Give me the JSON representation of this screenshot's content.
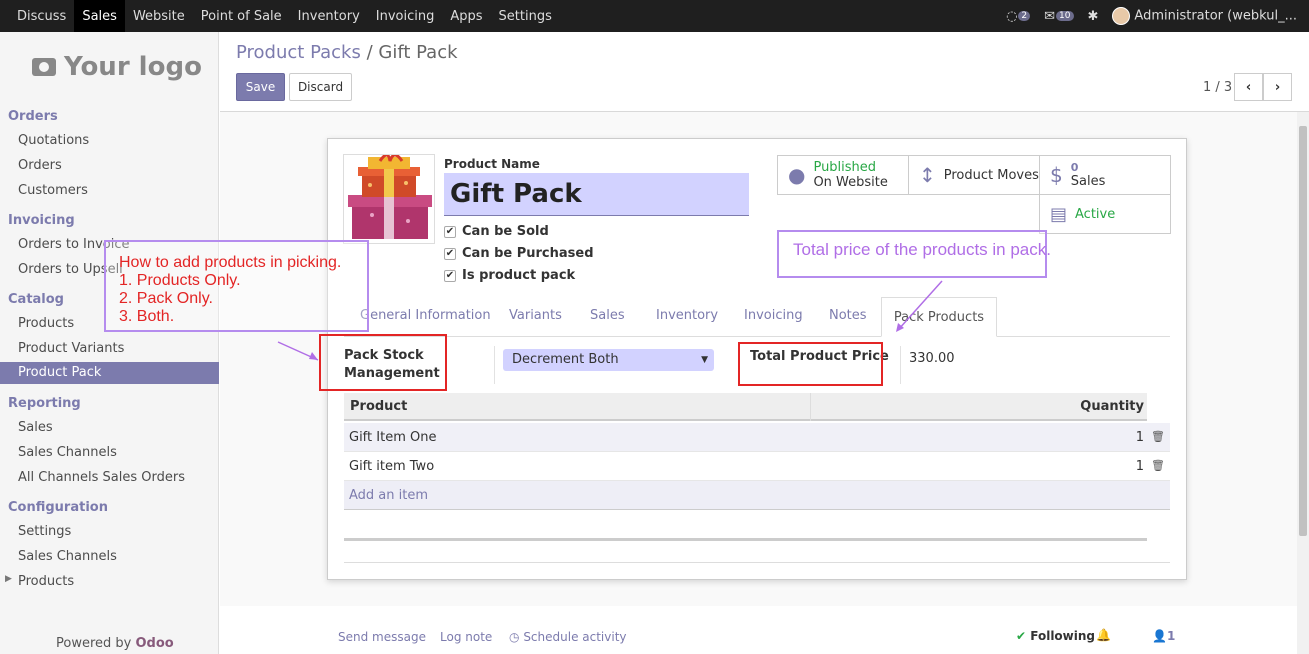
{
  "topbar": {
    "menu": [
      "Discuss",
      "Sales",
      "Website",
      "Point of Sale",
      "Inventory",
      "Invoicing",
      "Apps",
      "Settings"
    ],
    "active": "Sales",
    "chat_count": "2",
    "activity_count": "10",
    "user": "Administrator (webkul_..."
  },
  "sidebar": {
    "logo": "Your logo",
    "sections": {
      "orders": "Orders",
      "invoicing": "Invoicing",
      "catalog": "Catalog",
      "reporting": "Reporting",
      "configuration": "Configuration"
    },
    "items": {
      "quotations": "Quotations",
      "orders": "Orders",
      "customers": "Customers",
      "orders_to_invoice": "Orders to Invoice",
      "orders_to_upsell": "Orders to Upsell",
      "products": "Products",
      "product_variants": "Product Variants",
      "product_pack": "Product Pack",
      "sales": "Sales",
      "sales_channels": "Sales Channels",
      "all_channels": "All Channels Sales Orders",
      "settings": "Settings",
      "cfg_sales_channels": "Sales Channels",
      "cfg_products": "Products"
    },
    "powered_by": "Powered by",
    "powered_brand": "Odoo"
  },
  "control": {
    "breadcrumb_parent": "Product Packs",
    "breadcrumb_sep": "/",
    "breadcrumb_current": "Gift Pack",
    "save": "Save",
    "discard": "Discard",
    "pager": "1 / 3"
  },
  "form": {
    "product_name_label": "Product Name",
    "product_name": "Gift Pack",
    "can_be_sold": "Can be Sold",
    "can_be_purchased": "Can be Purchased",
    "is_product_pack": "Is product pack",
    "smart_buttons": {
      "published_line1": "Published",
      "published_line2": "On Website",
      "product_moves": "Product Moves",
      "sales_count": "0",
      "sales_label": "Sales",
      "active": "Active"
    },
    "tabs": [
      "General Information",
      "Variants",
      "Sales",
      "Inventory",
      "Invoicing",
      "Notes",
      "Pack Products"
    ],
    "active_tab": "Pack Products",
    "pack_stock_label_1": "Pack Stock",
    "pack_stock_label_2": "Management",
    "pack_stock_value": "Decrement Both",
    "total_price_label": "Total Product Price",
    "total_price_value": "330.00",
    "table": {
      "headers": [
        "Product",
        "Quantity"
      ],
      "rows": [
        {
          "product": "Gift Item One",
          "quantity": "1"
        },
        {
          "product": "Gift item Two",
          "quantity": "1"
        }
      ],
      "add_item": "Add an item"
    }
  },
  "chatter": {
    "send_message": "Send message",
    "log_note": "Log note",
    "schedule_activity": "Schedule activity",
    "following": "Following",
    "followers": "1"
  },
  "annotations": {
    "picking_title": "How to add products in picking.",
    "picking_1": "1.  Products Only.",
    "picking_2": "2. Pack Only.",
    "picking_3": "3. Both.",
    "total_note": "Total price of the products in pack."
  },
  "colors": {
    "brand": "#7c7bad",
    "topbar": "#1f1f1f",
    "annotation_red": "#e32525",
    "annotation_purple": "#b58cee"
  }
}
